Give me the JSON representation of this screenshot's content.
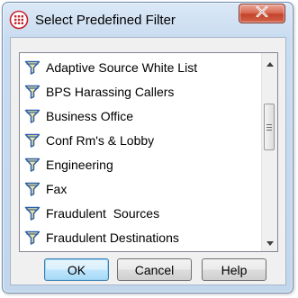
{
  "window": {
    "title": "Select Predefined Filter",
    "app_icon": "filter-app-icon",
    "close_icon": "close-x-icon"
  },
  "filter_list": {
    "item_icon": "funnel-icon",
    "items": [
      {
        "label": "Adaptive Source White List"
      },
      {
        "label": "BPS Harassing Callers"
      },
      {
        "label": "Business Office"
      },
      {
        "label": "Conf Rm's & Lobby"
      },
      {
        "label": "Engineering"
      },
      {
        "label": "Fax"
      },
      {
        "label": "Fraudulent  Sources"
      },
      {
        "label": "Fraudulent Destinations"
      }
    ]
  },
  "buttons": {
    "ok": "OK",
    "cancel": "Cancel",
    "help": "Help"
  },
  "colors": {
    "close_button": "#c2442c",
    "app_icon": "#c8202a",
    "funnel_fill": "#f7e69a",
    "funnel_stroke": "#2b5fa8",
    "default_button_border": "#3c7fb1"
  }
}
